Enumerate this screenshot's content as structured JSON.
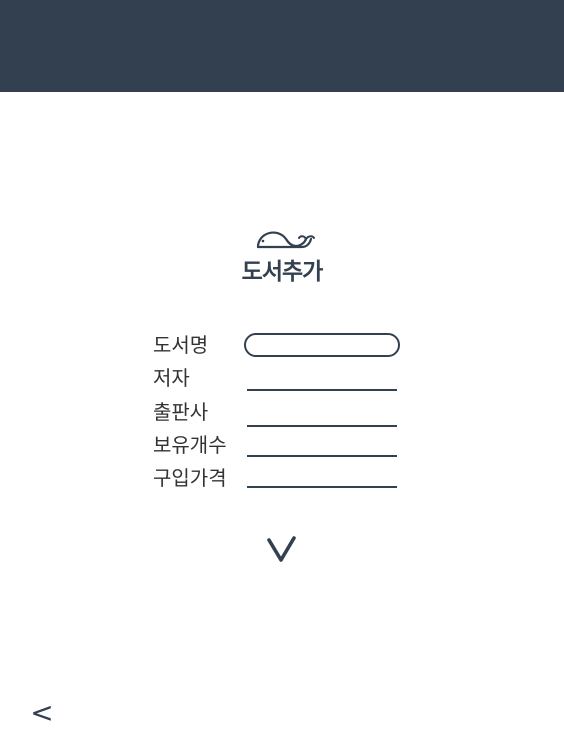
{
  "page": {
    "title": "도서추가"
  },
  "form": {
    "fields": [
      {
        "label": "도서명",
        "value": ""
      },
      {
        "label": "저자",
        "value": ""
      },
      {
        "label": "출판사",
        "value": ""
      },
      {
        "label": "보유개수",
        "value": ""
      },
      {
        "label": "구입가격",
        "value": ""
      }
    ]
  },
  "actions": {
    "submit_icon": "checkmark-icon",
    "back_label": "<"
  },
  "colors": {
    "header": "#33404f",
    "accent": "#33404f",
    "background": "#ffffff",
    "text": "#333333"
  }
}
